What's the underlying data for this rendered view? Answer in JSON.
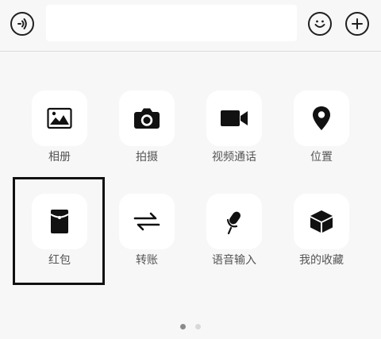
{
  "input_bar": {
    "voice_icon": "voice-input-icon",
    "emoji_icon": "emoji-icon",
    "plus_icon": "plus-icon",
    "text_value": ""
  },
  "panel": {
    "items": [
      {
        "label": "相册",
        "icon": "photo-album-icon"
      },
      {
        "label": "拍摄",
        "icon": "camera-icon"
      },
      {
        "label": "视频通话",
        "icon": "video-call-icon"
      },
      {
        "label": "位置",
        "icon": "location-icon"
      },
      {
        "label": "红包",
        "icon": "red-packet-icon"
      },
      {
        "label": "转账",
        "icon": "transfer-icon"
      },
      {
        "label": "语音输入",
        "icon": "voice-input-mic-icon"
      },
      {
        "label": "我的收藏",
        "icon": "favorites-icon"
      }
    ],
    "selected_label": "红包"
  },
  "pagination": {
    "page_count": 2,
    "current_page": 1
  },
  "colors": {
    "background": "#f7f7f7",
    "tile": "#ffffff",
    "icon": "#111111",
    "label": "#555555",
    "dot_active": "#8a8a8a",
    "dot_inactive": "#d8d8d8"
  }
}
